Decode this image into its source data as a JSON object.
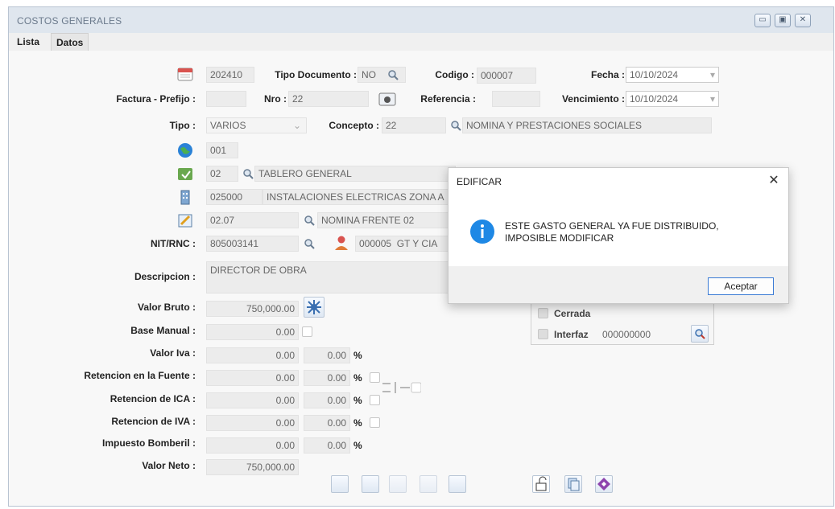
{
  "window": {
    "title": "COSTOS GENERALES"
  },
  "tabs": [
    {
      "label": "Lista"
    },
    {
      "label": "Datos"
    }
  ],
  "form": {
    "periodo": "202410",
    "tipo_documento": {
      "label": "Tipo Documento :",
      "value": "NO"
    },
    "codigo": {
      "label": "Codigo :",
      "value": "000007"
    },
    "fecha": {
      "label": "Fecha :",
      "value": "10/10/2024"
    },
    "factura_prefijo": {
      "label": "Factura - Prefijo :",
      "value": ""
    },
    "nro": {
      "label": "Nro :",
      "value": "22"
    },
    "referencia": {
      "label": "Referencia :",
      "value": ""
    },
    "vencimiento": {
      "label": "Vencimiento :",
      "value": "10/10/2024"
    },
    "tipo": {
      "label": "Tipo :",
      "value": "VARIOS"
    },
    "concepto": {
      "label": "Concepto :",
      "code": "22",
      "name": "NOMINA Y PRESTACIONES SOCIALES"
    },
    "sucursal": {
      "code": "001"
    },
    "proyecto": {
      "code": "02",
      "name": "TABLERO GENERAL"
    },
    "centro_costo": {
      "code": "025000",
      "name": "INSTALACIONES ELECTRICAS ZONA A"
    },
    "actividad": {
      "code": "02.07",
      "name": "NOMINA FRENTE 02"
    },
    "nit": {
      "label": "NIT/RNC :",
      "value": "805003141",
      "tercero_code": "000005",
      "tercero_name": "GT Y CIA"
    },
    "descripcion": {
      "label": "Descripcion :",
      "value": "DIRECTOR DE OBRA"
    }
  },
  "values": {
    "valor_bruto": {
      "label": "Valor Bruto :",
      "value": "750,000.00"
    },
    "base_manual": {
      "label": "Base Manual :",
      "value": "0.00"
    },
    "valor_iva": {
      "label": "Valor Iva :",
      "value": "0.00",
      "pct": "0.00"
    },
    "ret_fuente": {
      "label": "Retencion en la Fuente :",
      "value": "0.00",
      "pct": "0.00"
    },
    "ret_ica": {
      "label": "Retencion de ICA :",
      "value": "0.00",
      "pct": "0.00"
    },
    "ret_iva": {
      "label": "Retencion de IVA :",
      "value": "0.00",
      "pct": "0.00"
    },
    "bomberil": {
      "label": "Impuesto Bomberil :",
      "value": "0.00",
      "pct": "0.00"
    },
    "valor_neto": {
      "label": "Valor Neto :",
      "value": "750,000.00"
    },
    "pct_symbol": "%"
  },
  "status": {
    "cerrada": {
      "label": "Cerrada"
    },
    "interfaz": {
      "label": "Interfaz",
      "value": "000000000"
    }
  },
  "dialog": {
    "title": "EDIFICAR",
    "message": "ESTE GASTO GENERAL YA FUE DISTRIBUIDO, IMPOSIBLE MODIFICAR",
    "ok_label": "Aceptar",
    "close_glyph": "✕"
  },
  "icons": {
    "calendar": "calendar-icon",
    "search": "search-icon",
    "globe": "globe-icon",
    "project": "project-icon",
    "building": "building-icon",
    "task": "task-icon",
    "person": "person-icon",
    "info": "info-icon",
    "calculator": "calculator-icon"
  },
  "colors": {
    "accent": "#3a7bd5",
    "info": "#1e88e5",
    "titlebar": "#dfe6ee"
  }
}
